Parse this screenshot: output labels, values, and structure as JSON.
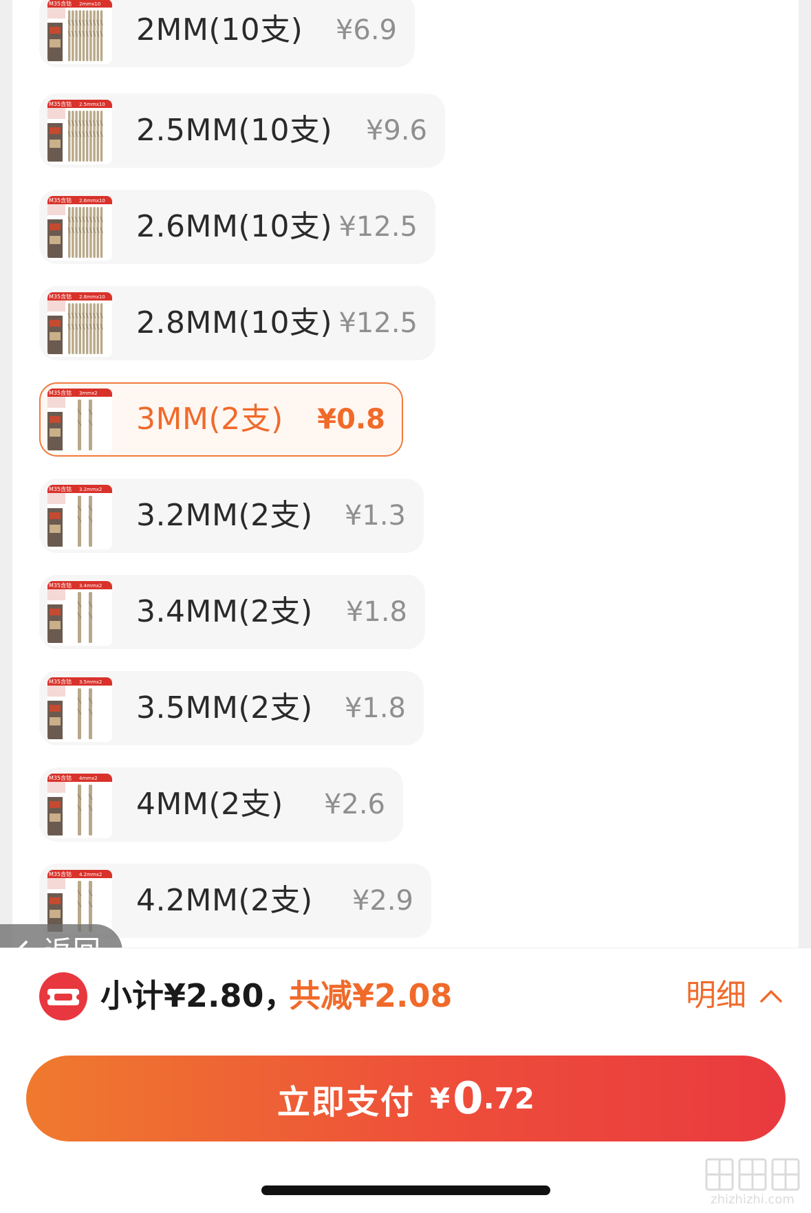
{
  "options": [
    {
      "thumb_badge": "M35含钴",
      "thumb_spec": "2mmx10",
      "thumb_bits": 10,
      "label": "2MM(10支)",
      "price": "¥6.9",
      "selected": false
    },
    {
      "thumb_badge": "M35含钴",
      "thumb_spec": "2.5mmx10",
      "thumb_bits": 10,
      "label": "2.5MM(10支)",
      "price": "¥9.6",
      "selected": false
    },
    {
      "thumb_badge": "M35含钴",
      "thumb_spec": "2.6mmx10",
      "thumb_bits": 10,
      "label": "2.6MM(10支)",
      "price": "¥12.5",
      "selected": false
    },
    {
      "thumb_badge": "M35含钴",
      "thumb_spec": "2.8mmx10",
      "thumb_bits": 10,
      "label": "2.8MM(10支)",
      "price": "¥12.5",
      "selected": false
    },
    {
      "thumb_badge": "M35含钴",
      "thumb_spec": "3mmx2",
      "thumb_bits": 2,
      "label": "3MM(2支)",
      "price": "¥0.8",
      "selected": true
    },
    {
      "thumb_badge": "M35含钴",
      "thumb_spec": "3.2mmx2",
      "thumb_bits": 2,
      "label": "3.2MM(2支)",
      "price": "¥1.3",
      "selected": false
    },
    {
      "thumb_badge": "M35含钴",
      "thumb_spec": "3.4mmx2",
      "thumb_bits": 2,
      "label": "3.4MM(2支)",
      "price": "¥1.8",
      "selected": false
    },
    {
      "thumb_badge": "M35含钴",
      "thumb_spec": "3.5mmx2",
      "thumb_bits": 2,
      "label": "3.5MM(2支)",
      "price": "¥1.8",
      "selected": false
    },
    {
      "thumb_badge": "M35含钴",
      "thumb_spec": "4mmx2",
      "thumb_bits": 2,
      "label": "4MM(2支)",
      "price": "¥2.6",
      "selected": false
    },
    {
      "thumb_badge": "M35含钴",
      "thumb_spec": "4.2mmx2",
      "thumb_bits": 2,
      "label": "4.2MM(2支)",
      "price": "¥2.9",
      "selected": false
    }
  ],
  "back": {
    "label": "返回",
    "icon": "chevron-left-icon"
  },
  "summary": {
    "subtotal": "小计¥2.80，",
    "discount": "共减¥2.08",
    "detail_label": "明细",
    "coupon_icon": "coupon-icon",
    "detail_icon": "chevron-up-icon"
  },
  "pay": {
    "label": "立即支付",
    "currency": "¥",
    "amount_int": "0",
    "amount_dec": ".72"
  },
  "watermark": {
    "text": "zhizhizhi.com"
  },
  "colors": {
    "accent": "#f06a2a",
    "option_bg": "#f6f6f6",
    "selected_bg": "#fff7f2",
    "pay_gradient_start": "#ef7a2e",
    "pay_gradient_end": "#e93a3f",
    "thumb_badge": "#d8322b"
  }
}
